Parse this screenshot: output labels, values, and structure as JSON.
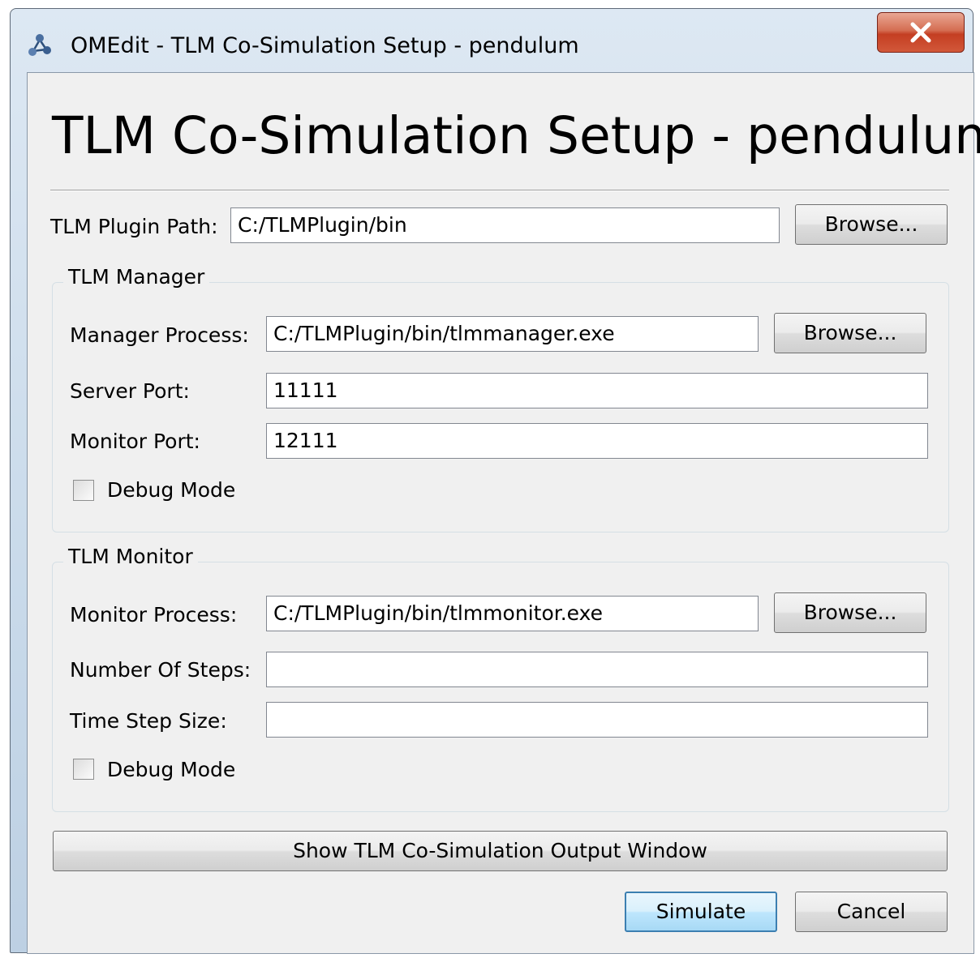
{
  "window": {
    "title": "OMEdit - TLM Co-Simulation Setup - pendulum",
    "close_label": "X"
  },
  "dialog": {
    "heading": "TLM Co-Simulation Setup - pendulum",
    "plugin_path_label": "TLM Plugin Path:",
    "plugin_path_value": "C:/TLMPlugin/bin",
    "browse_label": "Browse..."
  },
  "manager": {
    "group_title": "TLM Manager",
    "process_label": "Manager Process:",
    "process_value": "C:/TLMPlugin/bin/tlmmanager.exe",
    "server_port_label": "Server Port:",
    "server_port_value": "11111",
    "monitor_port_label": "Monitor Port:",
    "monitor_port_value": "12111",
    "debug_label": "Debug Mode",
    "debug_checked": false
  },
  "monitor": {
    "group_title": "TLM Monitor",
    "process_label": "Monitor Process:",
    "process_value": "C:/TLMPlugin/bin/tlmmonitor.exe",
    "steps_label": "Number Of Steps:",
    "steps_value": "",
    "step_size_label": "Time Step Size:",
    "step_size_value": "",
    "debug_label": "Debug Mode",
    "debug_checked": false
  },
  "actions": {
    "output_window_label": "Show TLM Co-Simulation Output Window",
    "simulate_label": "Simulate",
    "cancel_label": "Cancel"
  },
  "colors": {
    "titlebar": "#c9daea",
    "close_button": "#c43e22",
    "client_background": "#f0f0f0",
    "default_button_border": "#3c7fb1"
  }
}
